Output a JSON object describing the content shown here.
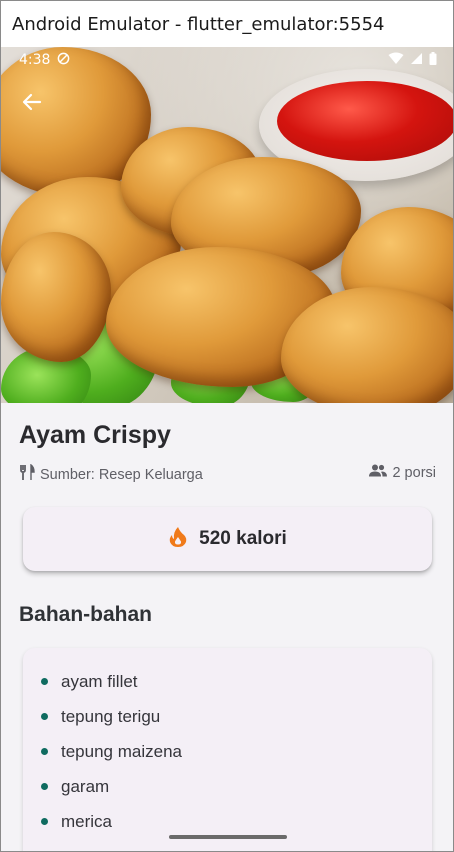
{
  "window": {
    "title": "Android Emulator - flutter_emulator:5554"
  },
  "status_bar": {
    "time": "4:38"
  },
  "recipe": {
    "title": "Ayam Crispy",
    "source": "Sumber: Resep Keluarga",
    "servings": "2 porsi",
    "calories": "520 kalori"
  },
  "ingredients": {
    "heading": "Bahan-bahan",
    "items": [
      "ayam fillet",
      " tepung terigu",
      " tepung maizena",
      " garam",
      " merica",
      " "
    ]
  },
  "colors": {
    "accent": "#0f6b60",
    "fire": "#f07a1a",
    "surface": "#f4eff6",
    "background": "#f4f3f6"
  },
  "icons": [
    "back-arrow-icon",
    "cutlery-icon",
    "people-icon",
    "fire-icon",
    "wifi-icon",
    "signal-icon",
    "battery-icon",
    "shield-icon"
  ]
}
